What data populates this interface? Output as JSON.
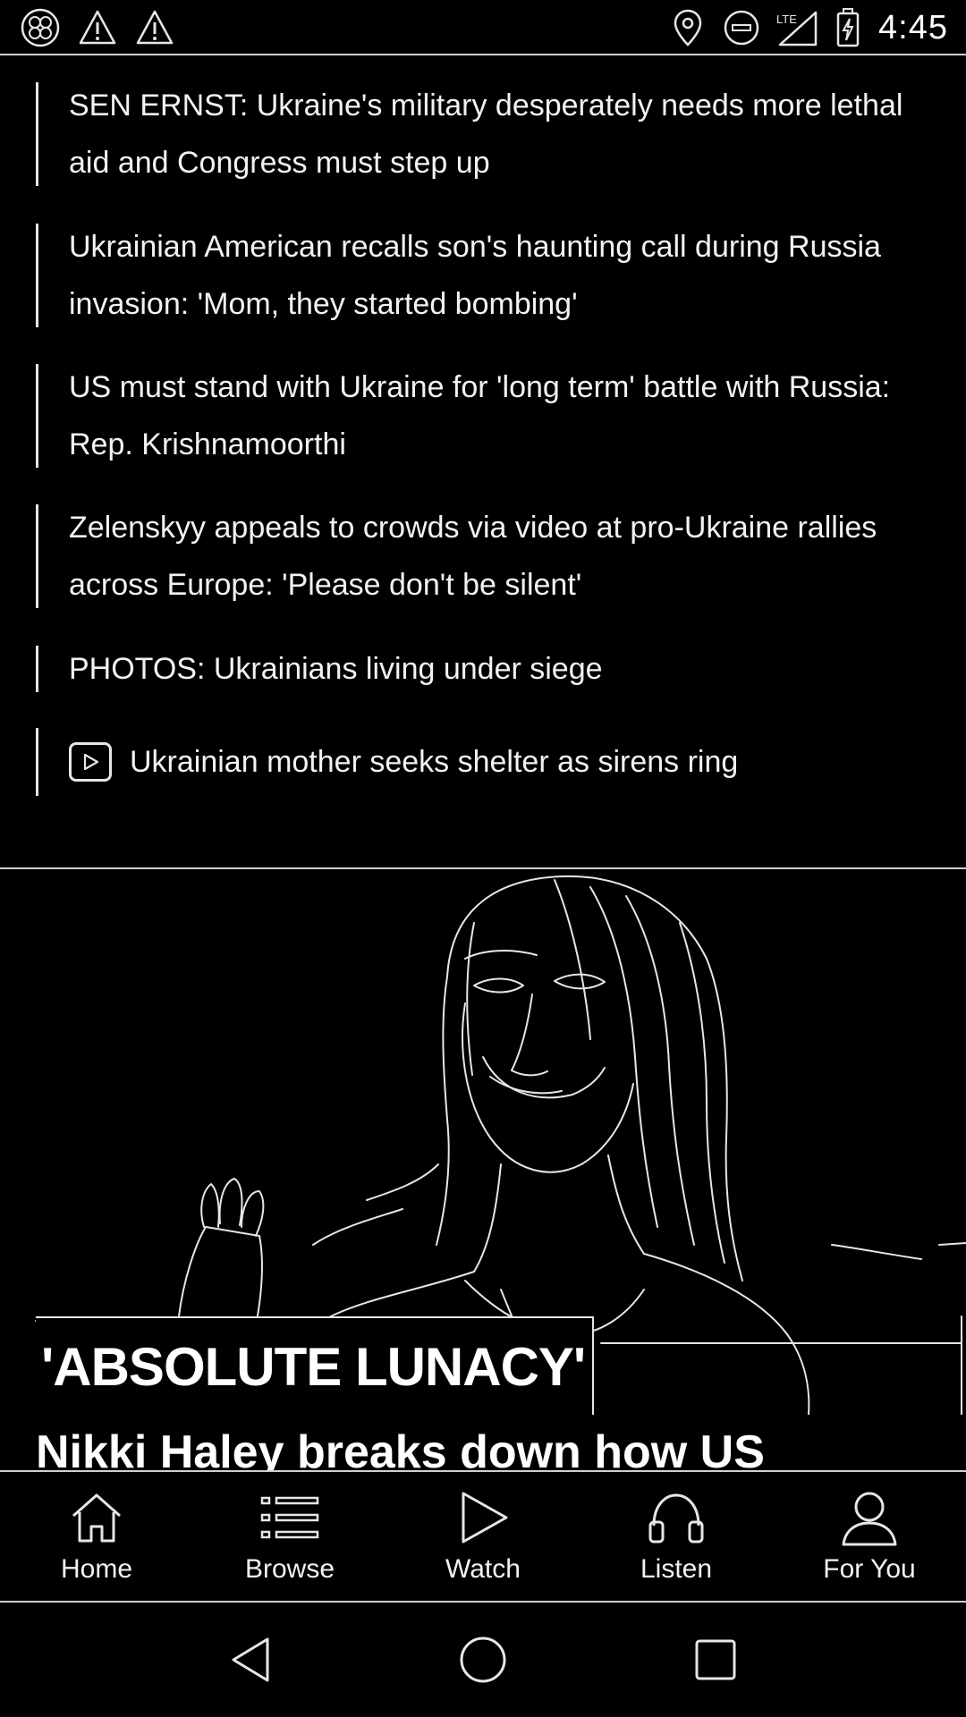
{
  "status_bar": {
    "time": "4:45",
    "left_icons": [
      "app-icon",
      "warning-icon",
      "warning-icon"
    ],
    "right_icons": [
      "location-icon",
      "do-not-disturb-icon",
      "lte-signal-icon",
      "battery-charging-icon"
    ],
    "network_label": "LTE"
  },
  "related": {
    "items": [
      {
        "text": "SEN ERNST: Ukraine's military desperately needs more lethal aid and Congress must step up"
      },
      {
        "text": "Ukrainian American recalls son's haunting call during Russia invasion: 'Mom, they started bombing'"
      },
      {
        "text": "US must stand with Ukraine for 'long term' battle with Russia: Rep. Krishnamoorthi"
      },
      {
        "text": "Zelenskyy appeals to crowds via video at pro-Ukraine rallies across Europe: 'Please don't be silent'"
      },
      {
        "text": "PHOTOS: Ukrainians living under siege"
      },
      {
        "text": "Ukrainian mother seeks shelter as sirens ring",
        "icon": "play-icon"
      }
    ]
  },
  "hero": {
    "kicker": "'ABSOLUTE LUNACY'",
    "headline": "Nikki Haley breaks down how US"
  },
  "tab_bar": {
    "tabs": [
      {
        "label": "Home",
        "icon": "home-icon"
      },
      {
        "label": "Browse",
        "icon": "list-icon"
      },
      {
        "label": "Watch",
        "icon": "play-icon"
      },
      {
        "label": "Listen",
        "icon": "headphones-icon"
      },
      {
        "label": "For You",
        "icon": "person-icon"
      }
    ]
  },
  "nav_bar": {
    "buttons": [
      "back-icon",
      "home-circle-icon",
      "recents-icon"
    ]
  },
  "colors": {
    "background": "#000000",
    "line": "#e6e6e6",
    "text": "#f2f2f2"
  }
}
